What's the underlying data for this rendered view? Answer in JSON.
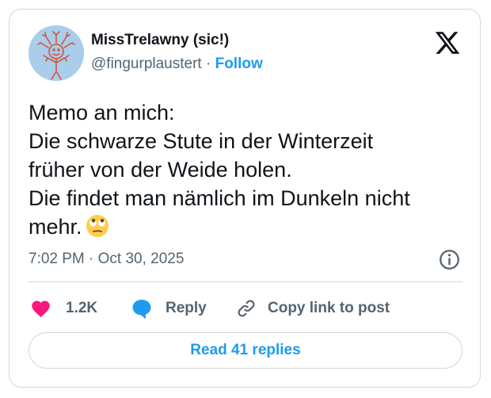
{
  "author": {
    "display_name": "MissTrelawny (sic!)",
    "handle": "@fingurplaustert",
    "separator": "·",
    "follow_label": "Follow"
  },
  "tweet": {
    "lines": [
      "Memo an mich:",
      "Die schwarze Stute in der Winterzeit",
      "früher von der Weide holen.",
      "Die findet man nämlich im Dunkeln nicht",
      "mehr."
    ],
    "emoji": "face-with-rolling-eyes",
    "timestamp": "7:02 PM · Oct 30, 2025"
  },
  "actions": {
    "like_count": "1.2K",
    "reply_label": "Reply",
    "copy_link_label": "Copy link to post"
  },
  "read_replies_label": "Read 41 replies",
  "icons": {
    "brand": "x-logo-icon",
    "info": "info-icon",
    "like": "heart-icon",
    "reply": "speech-bubble-icon",
    "copy": "link-icon"
  },
  "colors": {
    "accent": "#1d9bf0",
    "like": "#f91880",
    "text": "#0f1419",
    "secondary": "#536471",
    "border": "#cfd9de"
  }
}
